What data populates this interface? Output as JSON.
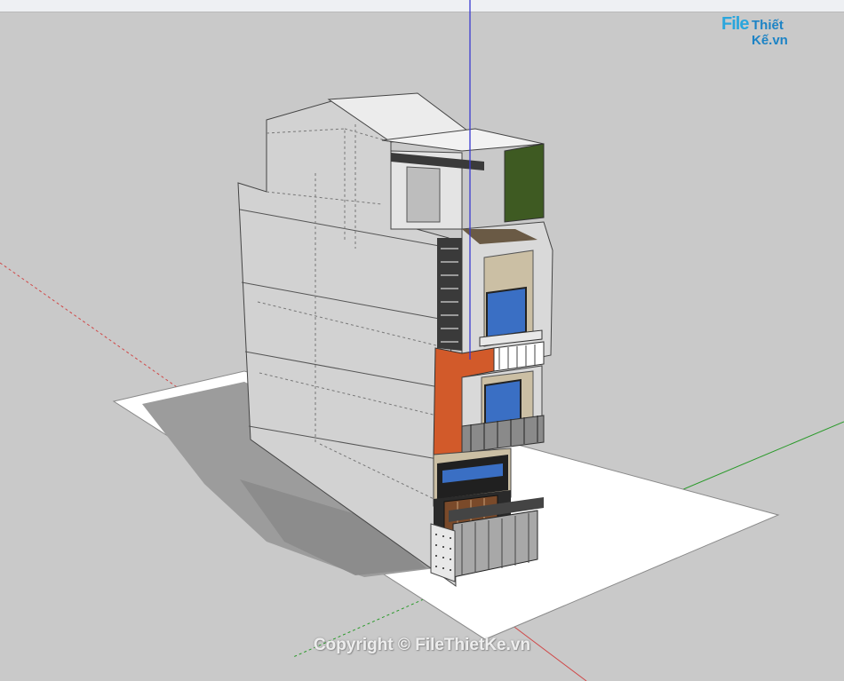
{
  "watermark": {
    "logo_file": "File",
    "logo_rest": "Thiết Kế.vn",
    "copyright": "Copyright © FileThietKe.vn"
  },
  "colors": {
    "background": "#c9c9c9",
    "ground": "#ffffff",
    "shadow": "#9a9a9a",
    "wall": "#cfcfcf",
    "accent_orange": "#d25a2a",
    "green_wall": "#3e5a22",
    "window_blue": "#3a6fc4",
    "beige": "#cbbfa4",
    "axis_red": "#d04848",
    "axis_green": "#2a9a2a",
    "axis_blue": "#3a3ad0"
  }
}
